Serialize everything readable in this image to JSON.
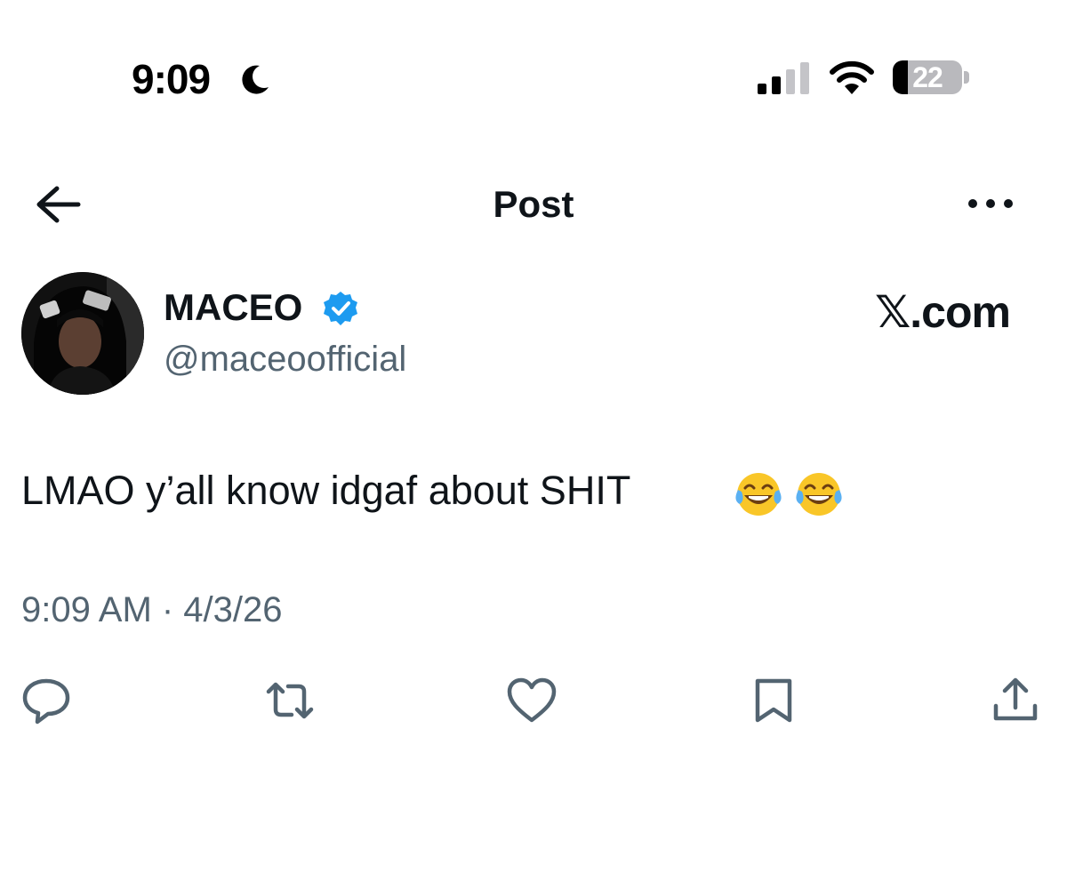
{
  "status_bar": {
    "time": "9:09",
    "battery_level": "22",
    "icons": [
      "moon-icon",
      "signal-icon",
      "wifi-icon",
      "battery-icon"
    ]
  },
  "header": {
    "title": "Post",
    "back_icon": "arrow-left-icon",
    "more_icon": "more-horizontal-icon"
  },
  "post": {
    "author_name": "MACEO",
    "author_handle": "@maceoofficial",
    "verified": true,
    "brand": "𝕏.com",
    "text": "LMAO y’all know idgaf about SHIT",
    "emoji": [
      "face-with-tears-of-joy",
      "face-with-tears-of-joy"
    ],
    "meta": "9:09 AM · 4/3/26"
  },
  "actions": [
    {
      "name": "reply",
      "icon": "reply-icon"
    },
    {
      "name": "repost",
      "icon": "repost-icon"
    },
    {
      "name": "like",
      "icon": "heart-icon"
    },
    {
      "name": "bookmark",
      "icon": "bookmark-icon"
    },
    {
      "name": "share",
      "icon": "share-icon"
    }
  ],
  "colors": {
    "text": "#0f1419",
    "secondary_text": "#536471",
    "verified_blue": "#1d9bf0",
    "background": "#ffffff"
  }
}
